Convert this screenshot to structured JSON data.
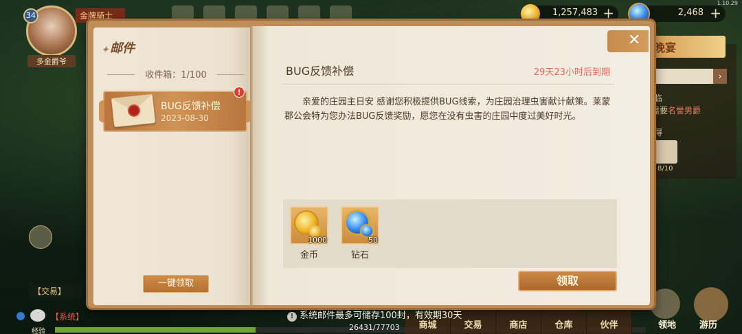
{
  "hud": {
    "level": "34",
    "title_text": "金牌骑士",
    "player_name": "多金爵爷",
    "gold_amount": "1,257,483",
    "diamond_amount": "2,468",
    "version": "1.10.29"
  },
  "background": {
    "banner_text": "晚宴",
    "side_text_1": "临",
    "side_text_2_prefix": "需要",
    "side_text_2_highlight": "名誉男爵",
    "side_text_3": "得",
    "side_item_count": "8/10",
    "trade_tag": "【交易】",
    "system_prefix": "【系统】",
    "exp_label": "经验",
    "exp_text": "26431/77703",
    "exp_progress": 0.34,
    "nav_items": [
      "商城",
      "交易",
      "商店",
      "仓库",
      "伙伴"
    ],
    "nav_left_label": "领地",
    "nav_right_label": "游历"
  },
  "mail": {
    "header": "邮件",
    "inbox_label": "收件箱：1/100",
    "claim_all_label": "一键领取",
    "items": [
      {
        "title": "BUG反馈补偿",
        "date": "2023-08-30",
        "badge": "!"
      }
    ],
    "detail": {
      "title": "BUG反馈补偿",
      "expire": "29天23小时后到期",
      "body": "亲爱的庄园主日安 感谢您积极提供BUG线索，为庄园治理虫害献计献策。莱蒙郡公会特为您办法BUG反馈奖励，愿您在没有虫害的庄园中度过美好时光。",
      "rewards": [
        {
          "name": "金币",
          "qty": "1000",
          "icon": "gold-coin-icon"
        },
        {
          "name": "钻石",
          "qty": "50",
          "icon": "diamond-icon"
        }
      ],
      "claim_label": "领取"
    },
    "close_icon": "close-icon",
    "footer_note": "系统邮件最多可储存100封，有效期30天"
  },
  "colors": {
    "accent_brown": "#b5702f",
    "expire_red": "#e06a5a",
    "alert_red": "#e23b2e"
  }
}
